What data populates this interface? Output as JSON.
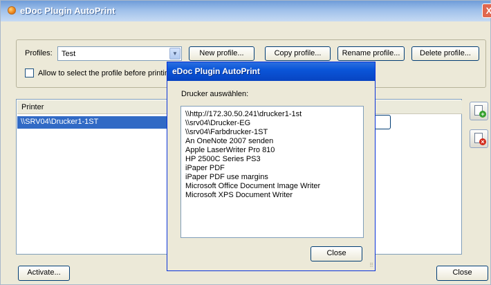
{
  "window": {
    "title": "eDoc Plugin AutoPrint",
    "close_glyph": "X"
  },
  "profiles": {
    "label": "Profiles:",
    "selected": "Test",
    "new_label": "New profile...",
    "copy_label": "Copy profile...",
    "rename_label": "Rename profile...",
    "delete_label": "Delete profile..."
  },
  "allow_select": {
    "label": "Allow to select the profile before printing",
    "checked": false
  },
  "printers": {
    "header": "Printer",
    "items": [
      "\\\\SRV04\\Drucker1-1ST"
    ]
  },
  "footer": {
    "activate_label": "Activate...",
    "close_label": "Close"
  },
  "dialog": {
    "title": "eDoc Plugin AutoPrint",
    "prompt": "Drucker auswählen:",
    "printers": [
      "\\\\http://172.30.50.241\\drucker1-1st",
      "\\\\srv04\\Drucker-EG",
      "\\\\srv04\\Farbdrucker-1ST",
      "An OneNote 2007 senden",
      "Apple LaserWriter Pro 810",
      "HP 2500C Series PS3",
      "iPaper PDF",
      "iPaper PDF use margins",
      "Microsoft Office Document Image Writer",
      "Microsoft XPS Document Writer"
    ],
    "close_label": "Close"
  },
  "icons": {
    "app": "edoc-app-icon",
    "add_printer": "add-printer-icon",
    "remove_printer": "remove-printer-icon"
  }
}
